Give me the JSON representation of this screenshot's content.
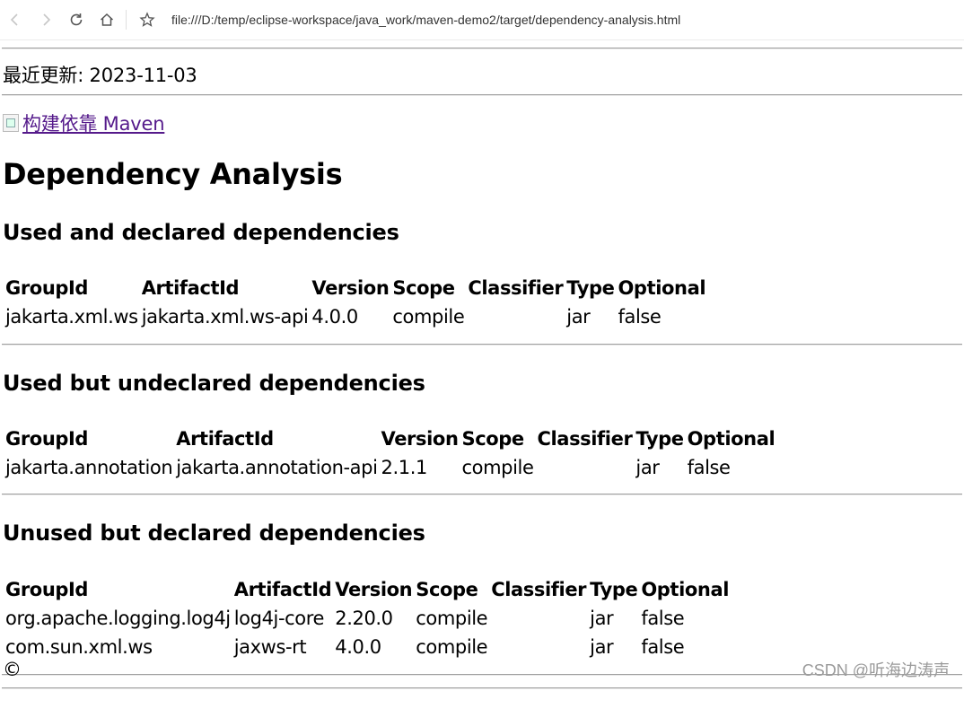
{
  "browser": {
    "url": "file:///D:/temp/eclipse-workspace/java_work/maven-demo2/target/dependency-analysis.html",
    "icons": [
      "back-icon",
      "forward-icon",
      "reload-icon",
      "home-icon",
      "bookmark-star-icon"
    ]
  },
  "page": {
    "last_updated": "最近更新: 2023-11-03",
    "maven_link_text": "构建依靠 Maven",
    "title": "Dependency Analysis",
    "footer_text": "©",
    "watermark": "CSDN @听海边涛声"
  },
  "table_headers": [
    "GroupId",
    "ArtifactId",
    "Version",
    "Scope",
    "Classifier",
    "Type",
    "Optional"
  ],
  "sections": [
    {
      "heading": "Used and declared dependencies",
      "rows": [
        [
          "jakarta.xml.ws",
          "jakarta.xml.ws-api",
          "4.0.0",
          "compile",
          "",
          "jar",
          "false"
        ]
      ]
    },
    {
      "heading": "Used but undeclared dependencies",
      "rows": [
        [
          "jakarta.annotation",
          "jakarta.annotation-api",
          "2.1.1",
          "compile",
          "",
          "jar",
          "false"
        ]
      ]
    },
    {
      "heading": "Unused but declared dependencies",
      "rows": [
        [
          "org.apache.logging.log4j",
          "log4j-core",
          "2.20.0",
          "compile",
          "",
          "jar",
          "false"
        ],
        [
          "com.sun.xml.ws",
          "jaxws-rt",
          "4.0.0",
          "compile",
          "",
          "jar",
          "false"
        ]
      ]
    }
  ],
  "colors": {
    "link_visited": "#551a8b",
    "watermark": "#9a9a9a"
  }
}
